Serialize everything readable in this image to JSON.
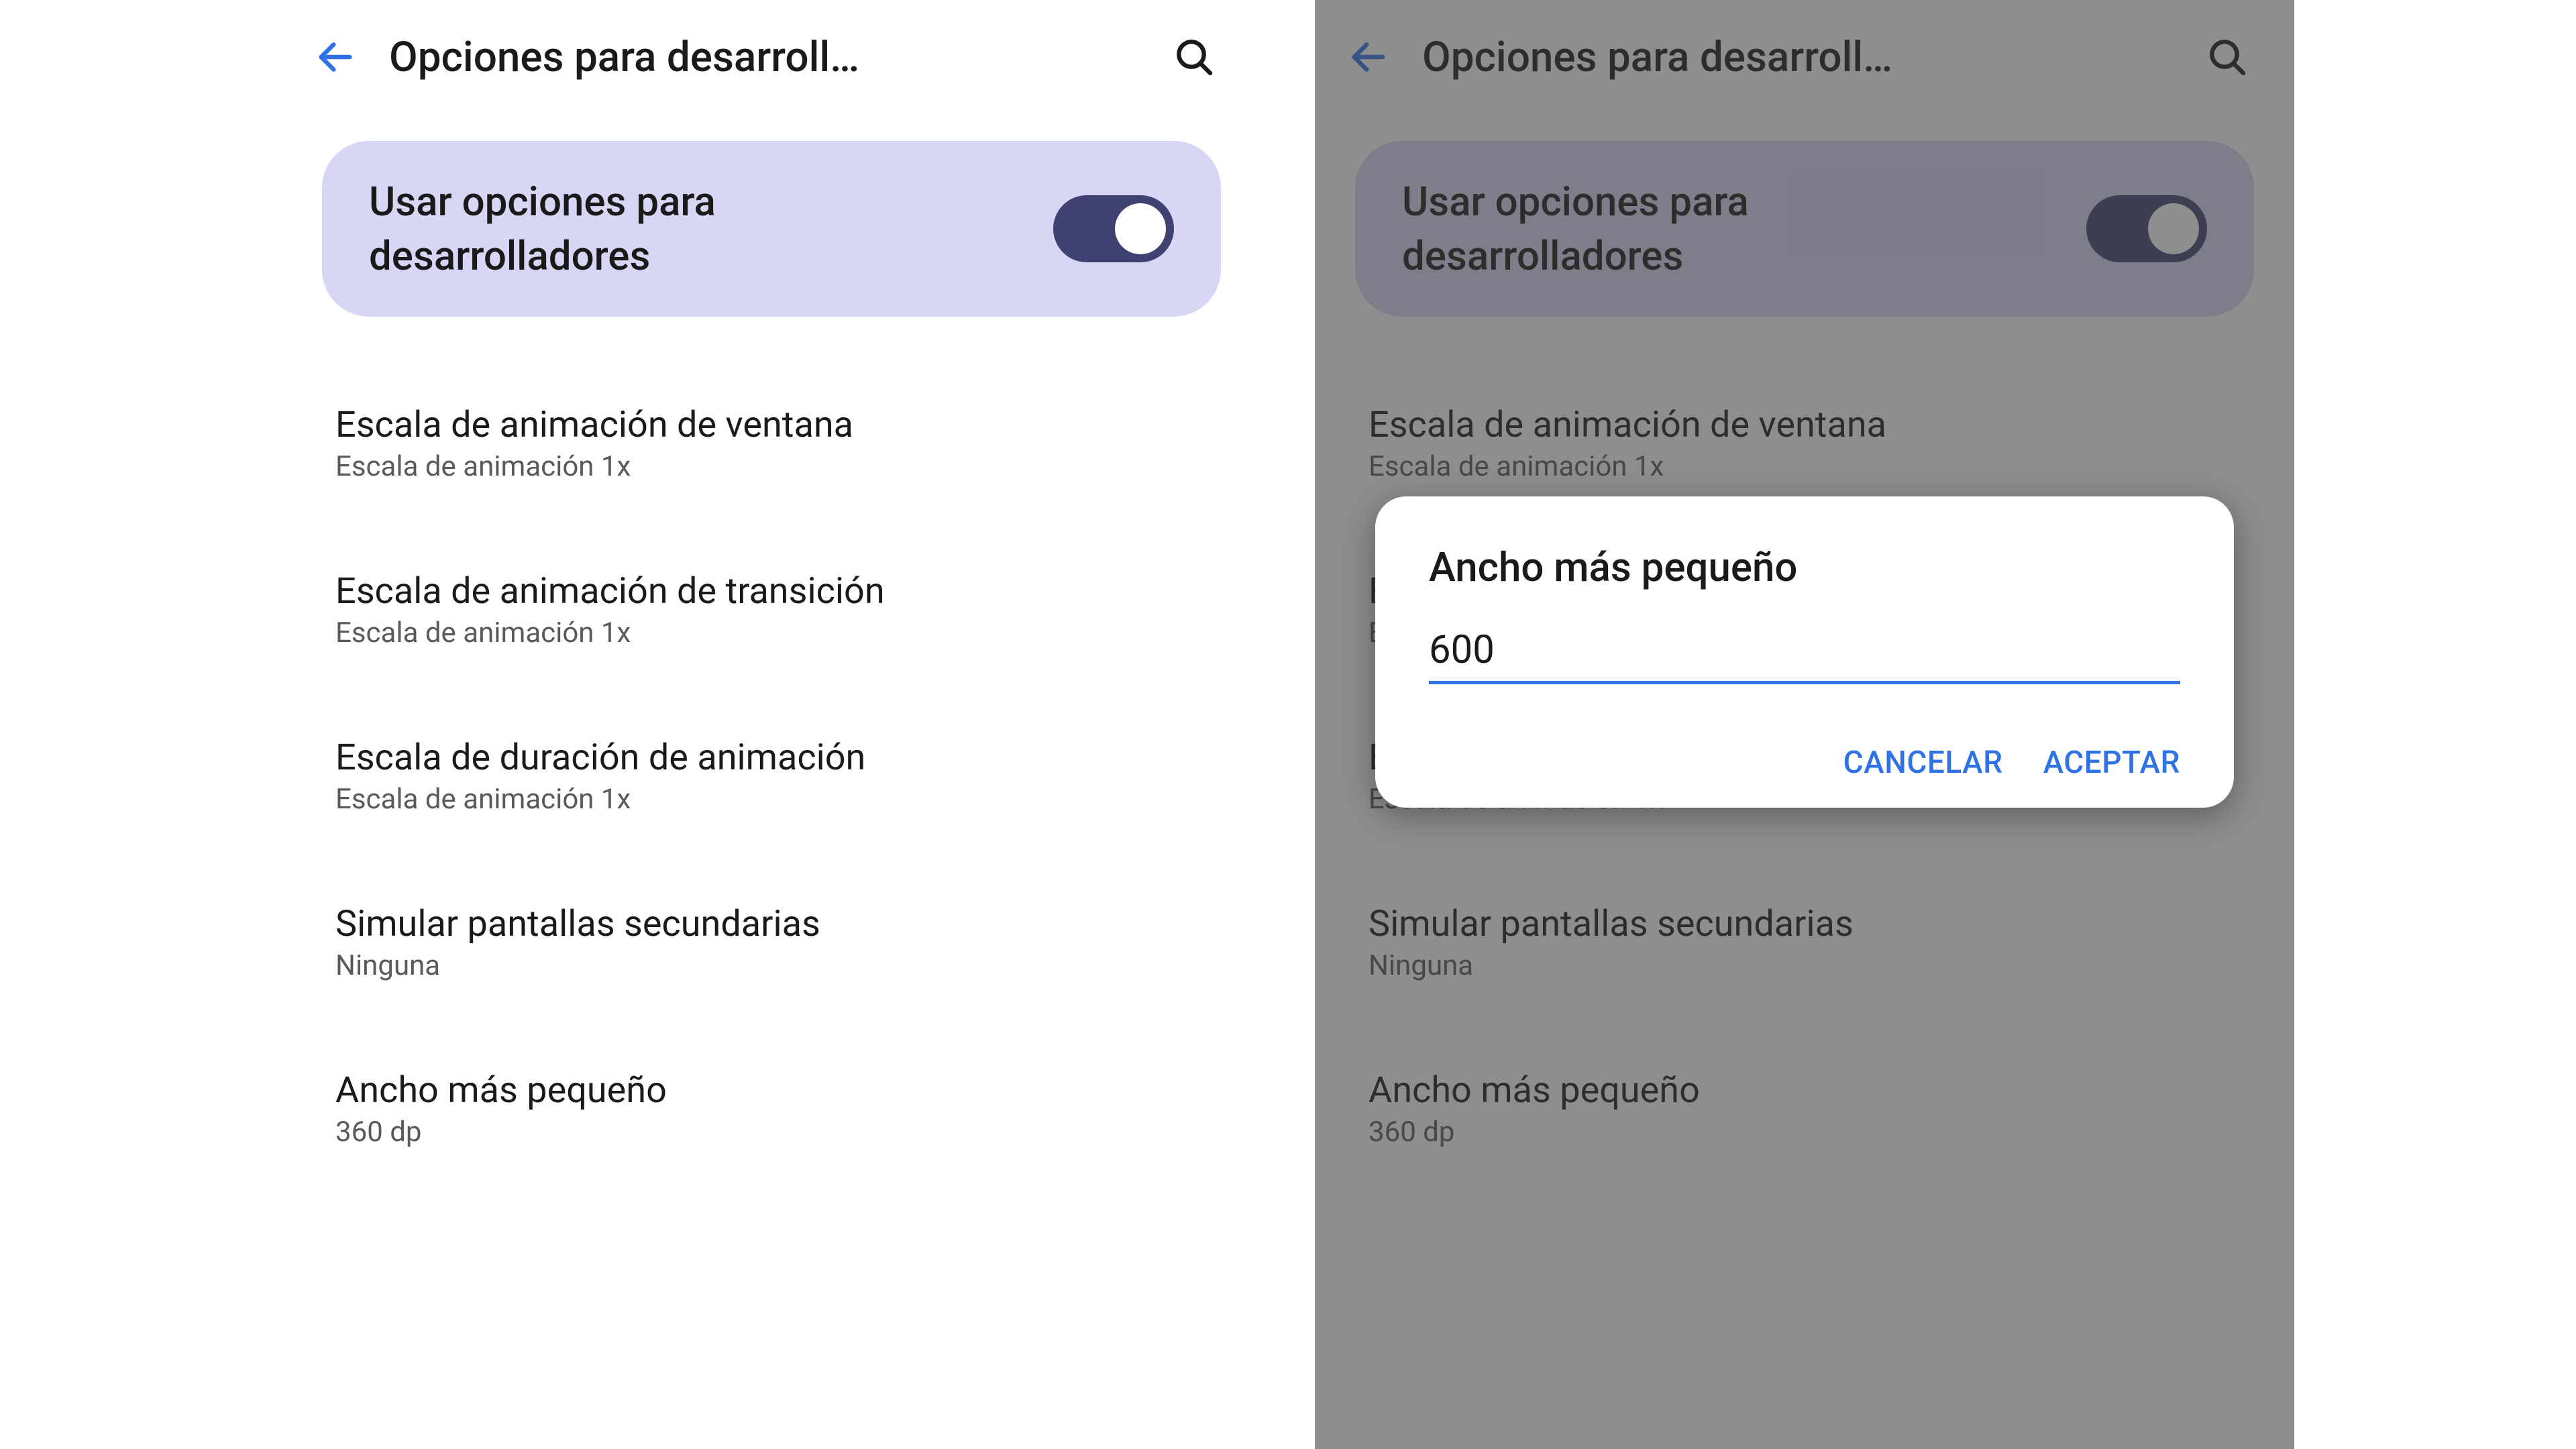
{
  "appbar": {
    "title": "Opciones para desarroll…"
  },
  "hero": {
    "label": "Usar opciones para desarrolladores"
  },
  "settings": [
    {
      "title": "Escala de animación de ventana",
      "subtitle": "Escala de animación 1x"
    },
    {
      "title": "Escala de animación de transición",
      "subtitle": "Escala de animación 1x"
    },
    {
      "title": "Escala de duración de animación",
      "subtitle": "Escala de animación 1x"
    },
    {
      "title": "Simular pantallas secundarias",
      "subtitle": "Ninguna"
    },
    {
      "title": "Ancho más pequeño",
      "subtitle": "360 dp"
    }
  ],
  "dialog": {
    "title": "Ancho más pequeño",
    "value": "600",
    "cancel": "CANCELAR",
    "accept": "ACEPTAR"
  },
  "colors": {
    "accent": "#2f72e6",
    "hero_bg": "#d8d6f5",
    "switch_track": "#3f4270"
  }
}
